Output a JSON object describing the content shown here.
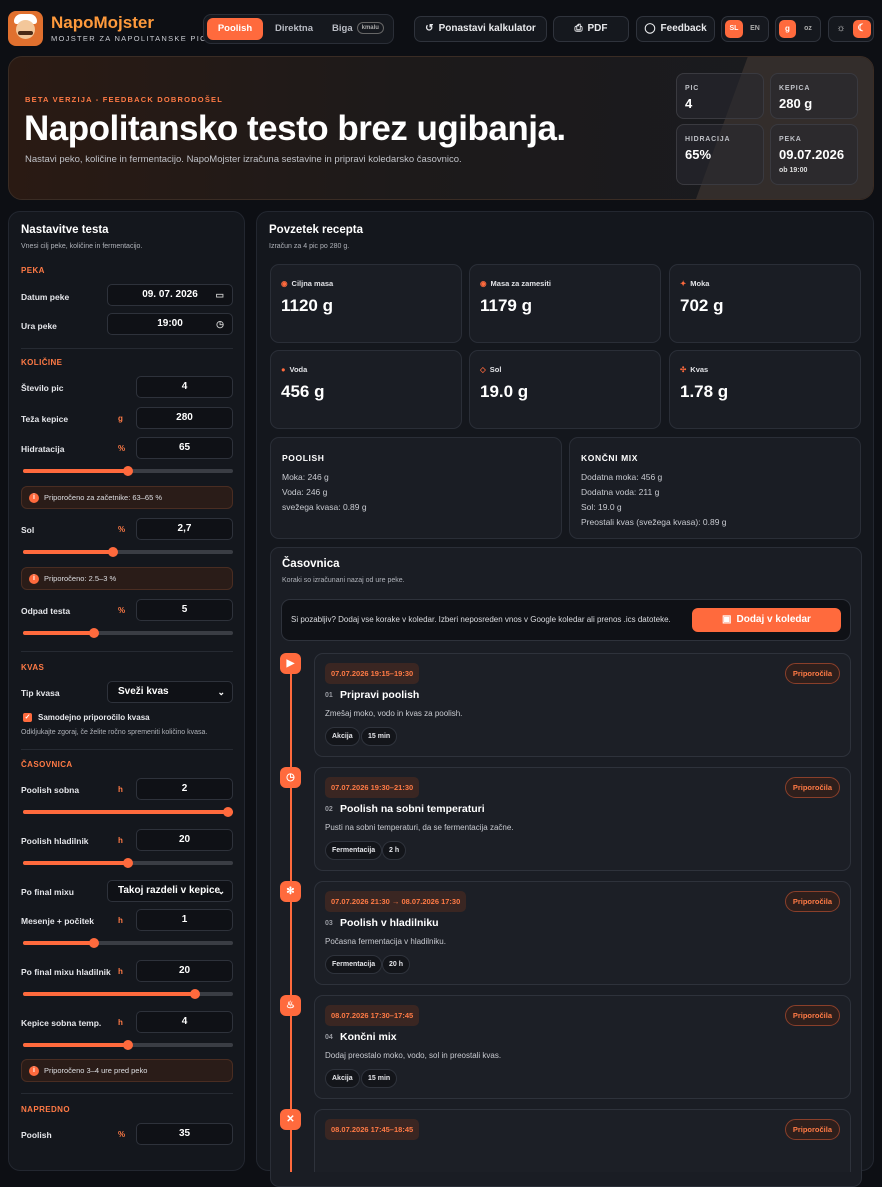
{
  "header": {
    "brand": "NapoMojster",
    "brand_sub": "MOJSTER ZA NAPOLITANSKE PICE",
    "modes": [
      "Poolish",
      "Direktna",
      "Biga"
    ],
    "biga_badge": "kmalu",
    "reset_label": "Ponastavi kalkulator",
    "pdf_label": "PDF",
    "feedback_label": "Feedback",
    "lang": [
      "SL",
      "EN"
    ],
    "units": [
      "g",
      "oz"
    ]
  },
  "hero": {
    "kicker": "BETA VERZIJA - FEEDBACK DOBRODOŠEL",
    "title": "Napolitansko testo brez ugibanja.",
    "description": "Nastavi peko, količine in fermentacijo. NapoMojster izračuna sestavine in pripravi koledarsko časovnico.",
    "stats": {
      "pic_label": "PIC",
      "pic_value": "4",
      "kepica_label": "KEPICA",
      "kepica_value": "280 g",
      "hidracija_label": "HIDRACIJA",
      "hidracija_value": "65%",
      "peka_label": "PEKA",
      "peka_value": "09.07.2026",
      "peka_sub": "ob 19:00"
    }
  },
  "settings": {
    "title": "Nastavitve testa",
    "subtitle": "Vnesi cilj peke, količine in fermentacijo.",
    "sec_peka": "PEKA",
    "datum_label": "Datum peke",
    "datum_value": "09. 07. 2026",
    "ura_label": "Ura peke",
    "ura_value": "19:00",
    "sec_kolicine": "KOLIČINE",
    "pic_label": "Število pic",
    "pic_value": "4",
    "teza_label": "Teža kepice",
    "teza_unit": "g",
    "teza_value": "280",
    "hidr_label": "Hidratacija",
    "hidr_unit": "%",
    "hidr_value": "65",
    "hidr_level": 0.5,
    "hidr_note": "Priporočeno za začetnike: 63–65 %",
    "sol_label": "Sol",
    "sol_unit": "%",
    "sol_value": "2,7",
    "sol_level": 0.43,
    "sol_note": "Priporočeno: 2.5–3 %",
    "odpad_label": "Odpad testa",
    "odpad_unit": "%",
    "odpad_value": "5",
    "odpad_level": 0.34,
    "sec_kvas": "KVAS",
    "tip_label": "Tip kvasa",
    "tip_value": "Sveži kvas",
    "auto_label": "Samodejno priporočilo kvasa",
    "auto_note": "Odkljukajte zgoraj, če želite ročno spremeniti količino kvasa.",
    "sec_casovnica": "ČASOVNICA",
    "ps_label": "Poolish sobna",
    "ps_unit": "h",
    "ps_value": "2",
    "ps_level": 1.0,
    "ph_label": "Poolish hladilnik",
    "ph_unit": "h",
    "ph_value": "20",
    "ph_level": 0.5,
    "pfm_label": "Po final mixu",
    "pfm_value": "Takoj razdeli v kepice",
    "mes_label": "Mesenje + počitek",
    "mes_unit": "h",
    "mes_value": "1",
    "mes_level": 0.34,
    "pfmh_label": "Po final mixu hladilnik",
    "pfmh_unit": "h",
    "pfmh_value": "20",
    "pfmh_level": 0.82,
    "kep_label": "Kepice sobna temp.",
    "kep_unit": "h",
    "kep_value": "4",
    "kep_level": 0.5,
    "kep_note": "Priporočeno 3–4 ure pred peko",
    "sec_napredno": "NAPREDNO",
    "adv_label": "Poolish",
    "adv_unit": "%",
    "adv_value": "35"
  },
  "summary": {
    "title": "Povzetek recepta",
    "subtitle": "Izračun za 4 pic po 280 g.",
    "metrics": [
      {
        "label": "Ciljna masa",
        "value": "1120 g",
        "icon": "scale-icon"
      },
      {
        "label": "Masa za zamesiti",
        "value": "1179 g",
        "icon": "dough-icon"
      },
      {
        "label": "Moka",
        "value": "702 g",
        "icon": "flour-icon"
      },
      {
        "label": "Voda",
        "value": "456 g",
        "icon": "drop-icon"
      },
      {
        "label": "Sol",
        "value": "19.0 g",
        "icon": "salt-icon"
      },
      {
        "label": "Kvas",
        "value": "1.78 g",
        "icon": "yeast-icon"
      }
    ],
    "poolish": {
      "title": "POOLISH",
      "lines": [
        "Moka: 246 g",
        "Voda: 246 g",
        "svežega kvasa: 0.89 g"
      ]
    },
    "koncni": {
      "title": "KONČNI MIX",
      "lines": [
        "Dodatna moka: 456 g",
        "Dodatna voda: 211 g",
        "Sol: 19.0 g",
        "Preostali kvas (svežega kvasa): 0.89 g"
      ]
    }
  },
  "timeline": {
    "title": "Časovnica",
    "subtitle": "Koraki so izračunani nazaj od ure peke.",
    "cal_text": "Si pozabljiv? Dodaj vse korake v koledar. Izberi neposreden vnos v Google koledar ali prenos .ics datoteke.",
    "cal_button": "Dodaj v koledar",
    "rec_label": "Priporočila",
    "steps": [
      {
        "time": "07.07.2026 19:15–19:30",
        "num": "01",
        "title": "Pripravi poolish",
        "desc": "Zmešaj moko, vodo in kvas za poolish.",
        "tags": [
          "Akcija",
          "15 min"
        ],
        "icon": "play-icon"
      },
      {
        "time": "07.07.2026 19:30–21:30",
        "num": "02",
        "title": "Poolish na sobni temperaturi",
        "desc": "Pusti na sobni temperaturi, da se fermentacija začne.",
        "tags": [
          "Fermentacija",
          "2 h"
        ],
        "icon": "clock-icon"
      },
      {
        "time": "07.07.2026 21:30 → 08.07.2026 17:30",
        "num": "03",
        "title": "Poolish v hladilniku",
        "desc": "Počasna fermentacija v hladilniku.",
        "tags": [
          "Fermentacija",
          "20 h"
        ],
        "icon": "snowflake-icon"
      },
      {
        "time": "08.07.2026 17:30–17:45",
        "num": "04",
        "title": "Končni mix",
        "desc": "Dodaj preostalo moko, vodo, sol in preostali kvas.",
        "tags": [
          "Akcija",
          "15 min"
        ],
        "icon": "chef-hat-icon"
      },
      {
        "time": "08.07.2026 17:45–18:45",
        "icon": "utensils-icon"
      }
    ]
  }
}
